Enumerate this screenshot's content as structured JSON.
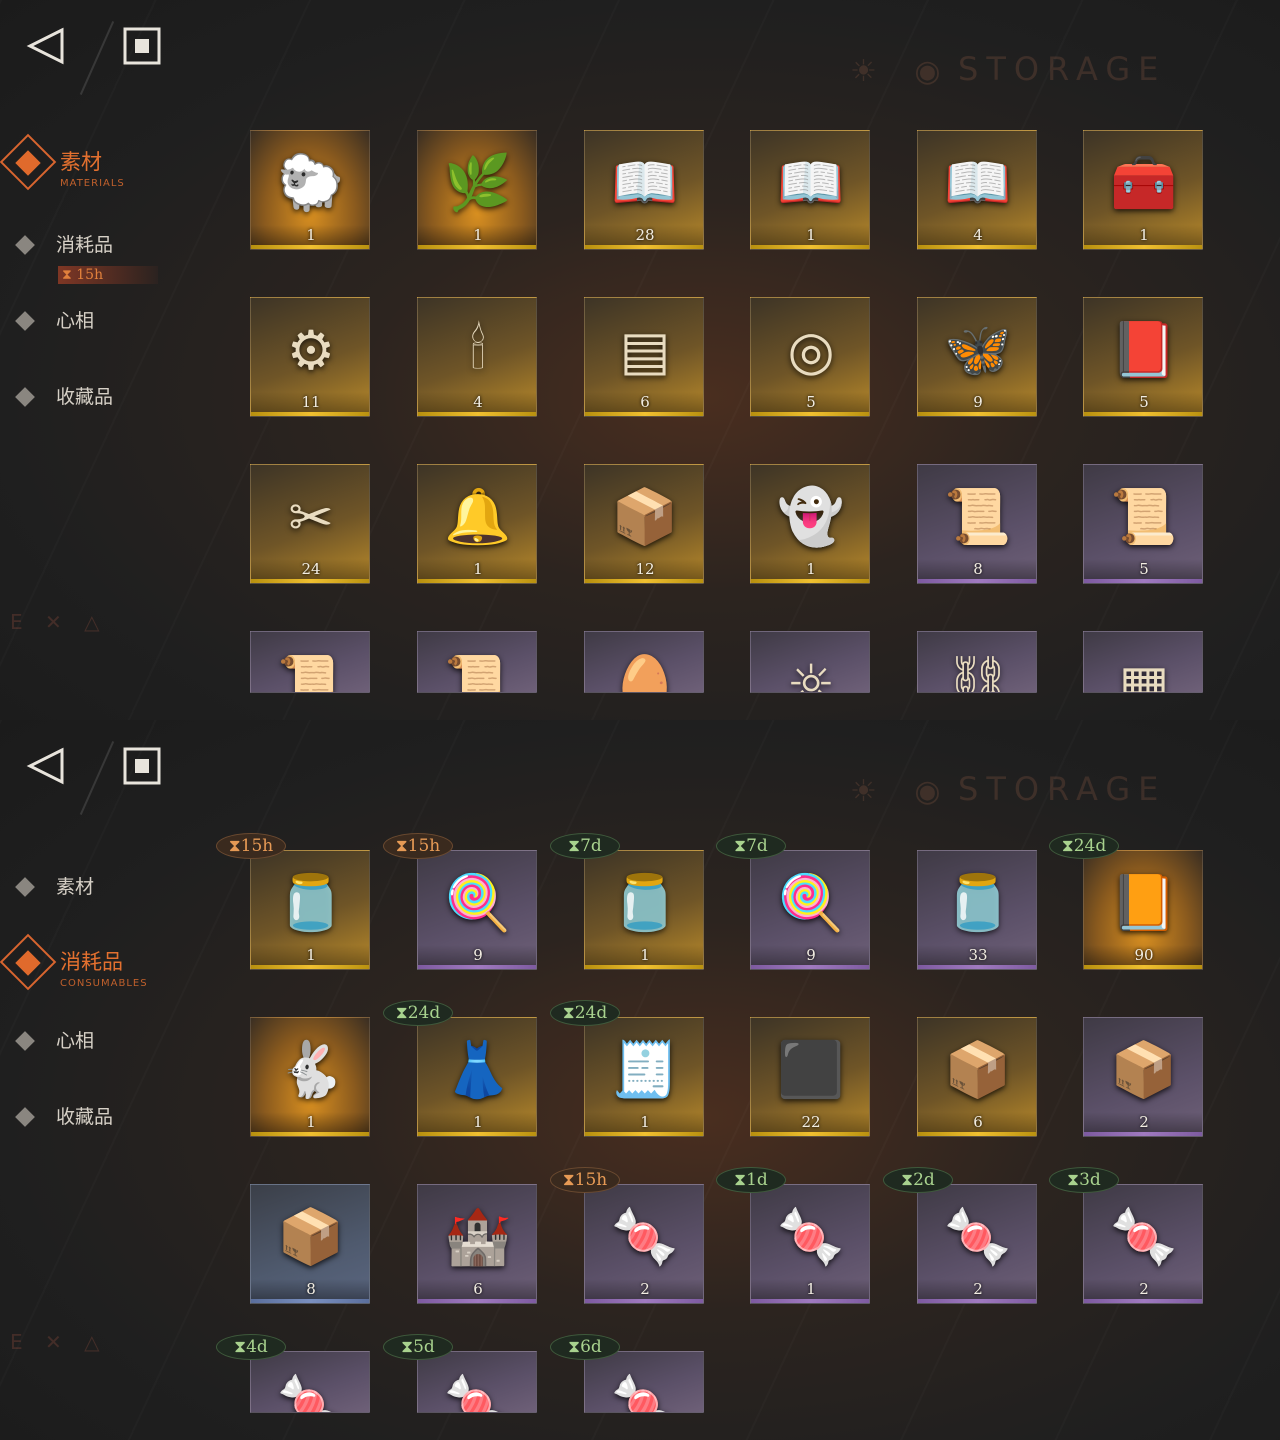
{
  "panels": [
    {
      "storage_title": "STORAGE",
      "nav": [
        {
          "label": "素材",
          "sub": "MATERIALS",
          "active": true
        },
        {
          "label": "消耗品",
          "sub": "",
          "active": false
        },
        {
          "label": "心相",
          "sub": "",
          "active": false
        },
        {
          "label": "收藏品",
          "sub": "",
          "active": false
        }
      ],
      "nav_timer": "⧗ 15h",
      "deco": "E ✕ △",
      "items": [
        {
          "icon": "sheep-figurine-icon",
          "glyph": "🐑",
          "qty": "1",
          "rarity": "gold2",
          "timer": null
        },
        {
          "icon": "laurel-wreath-icon",
          "glyph": "🌿",
          "qty": "1",
          "rarity": "gold2",
          "timer": null
        },
        {
          "icon": "open-book-red-icon",
          "glyph": "📖",
          "qty": "28",
          "rarity": "gold",
          "timer": null
        },
        {
          "icon": "open-book-green-icon",
          "glyph": "📖",
          "qty": "1",
          "rarity": "gold",
          "timer": null
        },
        {
          "icon": "open-book-blue-icon",
          "glyph": "📖",
          "qty": "4",
          "rarity": "gold",
          "timer": null
        },
        {
          "icon": "overgrown-chest-icon",
          "glyph": "🧰",
          "qty": "1",
          "rarity": "gold",
          "timer": null
        },
        {
          "icon": "astrolabe-icon",
          "glyph": "⚙",
          "qty": "11",
          "rarity": "gold",
          "timer": null
        },
        {
          "icon": "ouija-board-icon",
          "glyph": "🕯",
          "qty": "4",
          "rarity": "gold",
          "timer": null
        },
        {
          "icon": "green-tablet-icon",
          "glyph": "▤",
          "qty": "6",
          "rarity": "gold",
          "timer": null
        },
        {
          "icon": "pocket-watch-icon",
          "glyph": "◎",
          "qty": "5",
          "rarity": "gold",
          "timer": null
        },
        {
          "icon": "firefly-icon",
          "glyph": "🦋",
          "qty": "9",
          "rarity": "gold",
          "timer": null
        },
        {
          "icon": "dark-tome-icon",
          "glyph": "📕",
          "qty": "5",
          "rarity": "gold",
          "timer": null
        },
        {
          "icon": "crossed-bullets-icon",
          "glyph": "✂",
          "qty": "24",
          "rarity": "gold",
          "timer": null
        },
        {
          "icon": "glass-dome-icon",
          "glyph": "🔔",
          "qty": "1",
          "rarity": "gold",
          "timer": null
        },
        {
          "icon": "box-of-hands-icon",
          "glyph": "📦",
          "qty": "12",
          "rarity": "gold",
          "timer": null
        },
        {
          "icon": "ghost-icon",
          "glyph": "👻",
          "qty": "1",
          "rarity": "gold",
          "timer": null
        },
        {
          "icon": "scroll-red-icon",
          "glyph": "📜",
          "qty": "8",
          "rarity": "purple",
          "timer": null
        },
        {
          "icon": "scroll-green-icon",
          "glyph": "📜",
          "qty": "5",
          "rarity": "purple",
          "timer": null
        },
        {
          "icon": "scroll-blue-icon",
          "glyph": "📜",
          "qty": "",
          "rarity": "purple",
          "timer": null
        },
        {
          "icon": "scroll-gold-icon",
          "glyph": "📜",
          "qty": "",
          "rarity": "purple",
          "timer": null
        },
        {
          "icon": "heart-egg-icon",
          "glyph": "🥚",
          "qty": "",
          "rarity": "purple",
          "timer": null
        },
        {
          "icon": "amulet-icon",
          "glyph": "☼",
          "qty": "",
          "rarity": "purple",
          "timer": null
        },
        {
          "icon": "chain-icon",
          "glyph": "⛓",
          "qty": "",
          "rarity": "purple",
          "timer": null
        },
        {
          "icon": "stone-slab-icon",
          "glyph": "▦",
          "qty": "",
          "rarity": "purple",
          "timer": null
        }
      ]
    },
    {
      "storage_title": "STORAGE",
      "nav": [
        {
          "label": "素材",
          "sub": "",
          "active": false
        },
        {
          "label": "消耗品",
          "sub": "CONSUMABLES",
          "active": true
        },
        {
          "label": "心相",
          "sub": "",
          "active": false
        },
        {
          "label": "收藏品",
          "sub": "",
          "active": false
        }
      ],
      "nav_timer": "",
      "deco": "E ✕ △",
      "items": [
        {
          "icon": "candy-jar-icon",
          "glyph": "🫙",
          "qty": "1",
          "rarity": "gold",
          "timer": {
            "text": "⧗15h",
            "color": "orange"
          }
        },
        {
          "icon": "lollipops-icon",
          "glyph": "🍭",
          "qty": "9",
          "rarity": "purple",
          "timer": {
            "text": "⧗15h",
            "color": "orange"
          }
        },
        {
          "icon": "candy-jar-icon",
          "glyph": "🫙",
          "qty": "1",
          "rarity": "gold",
          "timer": {
            "text": "⧗7d",
            "color": "green"
          }
        },
        {
          "icon": "lollipops-icon",
          "glyph": "🍭",
          "qty": "9",
          "rarity": "purple",
          "timer": {
            "text": "⧗7d",
            "color": "green"
          }
        },
        {
          "icon": "candy-jar-icon",
          "glyph": "🫙",
          "qty": "33",
          "rarity": "purple",
          "timer": null
        },
        {
          "icon": "rune-book-icon",
          "glyph": "📙",
          "qty": "90",
          "rarity": "gold2",
          "timer": {
            "text": "⧗24d",
            "color": "green"
          }
        },
        {
          "icon": "rabbit-box-icon",
          "glyph": "🐇",
          "qty": "1",
          "rarity": "gold2",
          "timer": null
        },
        {
          "icon": "mannequin-icon",
          "glyph": "👗",
          "qty": "1",
          "rarity": "gold",
          "timer": {
            "text": "⧗24d",
            "color": "green"
          }
        },
        {
          "icon": "shopping-list-icon",
          "glyph": "🧾",
          "qty": "1",
          "rarity": "gold",
          "timer": {
            "text": "⧗24d",
            "color": "green"
          }
        },
        {
          "icon": "rune-cube-icon",
          "glyph": "⬛",
          "qty": "22",
          "rarity": "gold",
          "timer": null
        },
        {
          "icon": "parcel-icon",
          "glyph": "📦",
          "qty": "6",
          "rarity": "gold",
          "timer": null
        },
        {
          "icon": "parcel-icon",
          "glyph": "📦",
          "qty": "2",
          "rarity": "purple",
          "timer": null
        },
        {
          "icon": "parcel-icon",
          "glyph": "📦",
          "qty": "8",
          "rarity": "blue",
          "timer": null
        },
        {
          "icon": "sand-castle-icon",
          "glyph": "🏰",
          "qty": "6",
          "rarity": "purple",
          "timer": null
        },
        {
          "icon": "candies-icon",
          "glyph": "🍬",
          "qty": "2",
          "rarity": "purple",
          "timer": {
            "text": "⧗15h",
            "color": "orange"
          }
        },
        {
          "icon": "candies-icon",
          "glyph": "🍬",
          "qty": "1",
          "rarity": "purple",
          "timer": {
            "text": "⧗1d",
            "color": "green"
          }
        },
        {
          "icon": "candies-icon",
          "glyph": "🍬",
          "qty": "2",
          "rarity": "purple",
          "timer": {
            "text": "⧗2d",
            "color": "green"
          }
        },
        {
          "icon": "candies-icon",
          "glyph": "🍬",
          "qty": "2",
          "rarity": "purple",
          "timer": {
            "text": "⧗3d",
            "color": "green"
          }
        },
        {
          "icon": "candies-icon",
          "glyph": "🍬",
          "qty": "",
          "rarity": "purple",
          "timer": {
            "text": "⧗4d",
            "color": "green"
          }
        },
        {
          "icon": "candies-icon",
          "glyph": "🍬",
          "qty": "",
          "rarity": "purple",
          "timer": {
            "text": "⧗5d",
            "color": "green"
          }
        },
        {
          "icon": "candies-icon",
          "glyph": "🍬",
          "qty": "",
          "rarity": "purple",
          "timer": {
            "text": "⧗6d",
            "color": "green"
          }
        }
      ]
    }
  ]
}
